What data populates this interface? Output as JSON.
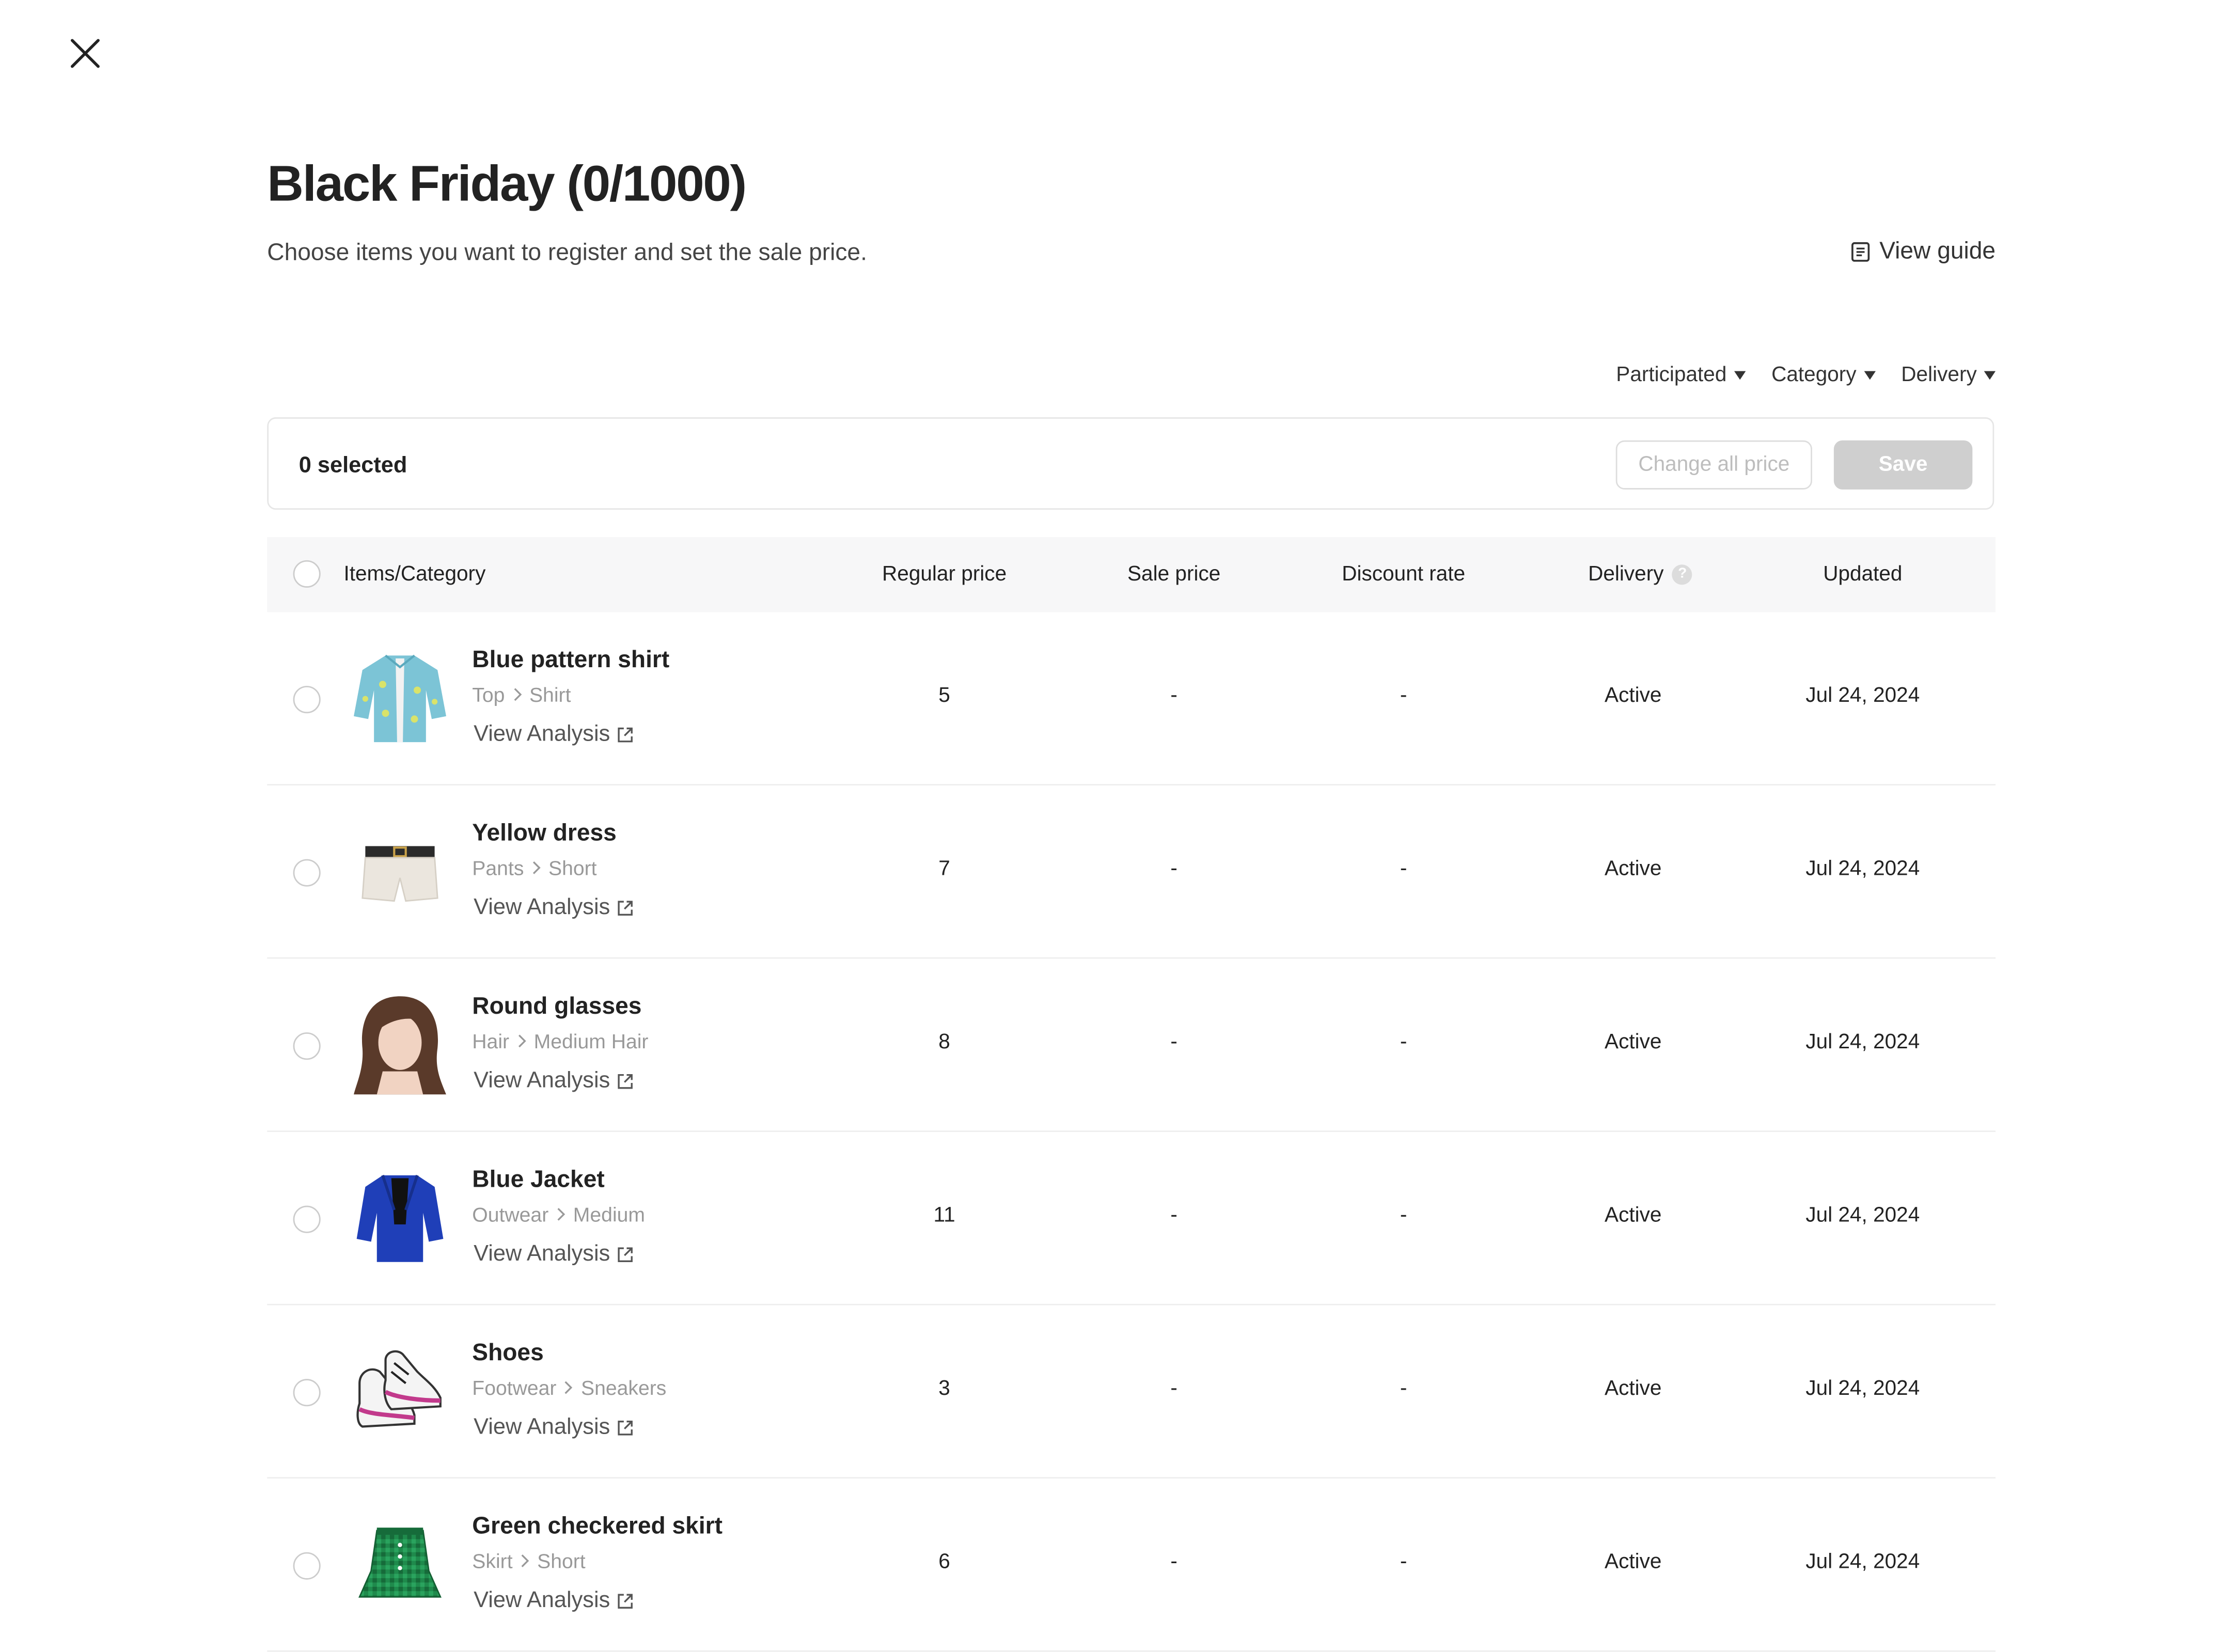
{
  "page": {
    "title": "Black Friday (0/1000)",
    "subtitle": "Choose items you want to register and set the sale price.",
    "view_guide": "View guide"
  },
  "filters": [
    "Participated",
    "Category",
    "Delivery"
  ],
  "toolbar": {
    "selected": "0 selected",
    "change_all_price": "Change all price",
    "save": "Save"
  },
  "table": {
    "headers": {
      "items": "Items/Category",
      "regular_price": "Regular price",
      "sale_price": "Sale price",
      "discount_rate": "Discount rate",
      "delivery": "Delivery",
      "delivery_help": "?",
      "updated": "Updated"
    },
    "rows": [
      {
        "name": "Blue pattern shirt",
        "cat1": "Top",
        "cat2": "Shirt",
        "link": "View Analysis",
        "regular": "5",
        "sale": "-",
        "discount": "-",
        "delivery": "Active",
        "updated": "Jul 24, 2024",
        "image_icon": "shirt-icon"
      },
      {
        "name": "Yellow dress",
        "cat1": "Pants",
        "cat2": "Short",
        "link": "View Analysis",
        "regular": "7",
        "sale": "-",
        "discount": "-",
        "delivery": "Active",
        "updated": "Jul 24, 2024",
        "image_icon": "shorts-icon"
      },
      {
        "name": "Round glasses",
        "cat1": "Hair",
        "cat2": "Medium Hair",
        "link": "View Analysis",
        "regular": "8",
        "sale": "-",
        "discount": "-",
        "delivery": "Active",
        "updated": "Jul 24, 2024",
        "image_icon": "hair-icon"
      },
      {
        "name": "Blue Jacket",
        "cat1": "Outwear",
        "cat2": "Medium",
        "link": "View Analysis",
        "regular": "11",
        "sale": "-",
        "discount": "-",
        "delivery": "Active",
        "updated": "Jul 24, 2024",
        "image_icon": "jacket-icon"
      },
      {
        "name": "Shoes",
        "cat1": "Footwear",
        "cat2": "Sneakers",
        "link": "View Analysis",
        "regular": "3",
        "sale": "-",
        "discount": "-",
        "delivery": "Active",
        "updated": "Jul 24, 2024",
        "image_icon": "sneakers-icon"
      },
      {
        "name": "Green checkered skirt",
        "cat1": "Skirt",
        "cat2": "Short",
        "link": "View Analysis",
        "regular": "6",
        "sale": "-",
        "discount": "-",
        "delivery": "Active",
        "updated": "Jul 24, 2024",
        "image_icon": "skirt-icon"
      }
    ]
  },
  "icons": {
    "close": "close-icon",
    "guide": "document-icon",
    "dropdown": "caret-down-icon",
    "external": "external-link-icon",
    "separator": "chevron-right-icon"
  },
  "colors": {
    "text": "#222222",
    "muted": "#999999",
    "border": "#e6e6e6",
    "header_bg": "#f7f7f8",
    "save_disabled": "#cfcfcf"
  }
}
